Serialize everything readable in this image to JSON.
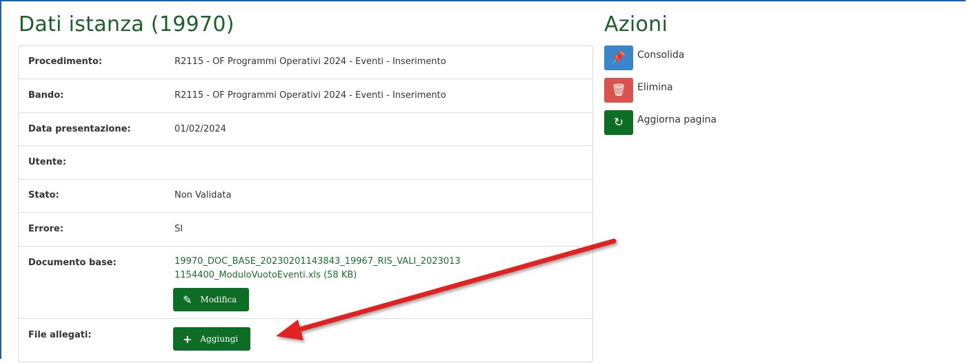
{
  "page": {
    "title": "Dati istanza (19970)",
    "actions_title": "Azioni"
  },
  "details": [
    {
      "label": "Procedimento:",
      "value": "R2115 - OF Programmi Operativi 2024  - Eventi - Inserimento"
    },
    {
      "label": "Bando:",
      "value": "R2115 - OF Programmi Operativi 2024  - Eventi - Inserimento"
    },
    {
      "label": "Data presentazione:",
      "value": "01/02/2024"
    },
    {
      "label": "Utente:",
      "value": ""
    },
    {
      "label": "Stato:",
      "value": "Non Validata"
    },
    {
      "label": "Errore:",
      "value": "SI"
    }
  ],
  "documento_base": {
    "label": "Documento base:",
    "file_link": "19970_DOC_BASE_20230201143843_19967_RIS_VALI_2023013 1154400_ModuloVuotoEventi.xls (58 KB)",
    "button_label": "Modifica",
    "button_icon": "pencil-icon"
  },
  "file_allegati": {
    "label": "File allegati:",
    "button_label": "Aggiungi",
    "button_icon": "plus-icon"
  },
  "actions": [
    {
      "label": "Consolida",
      "icon": "pin-icon",
      "color": "#3a86c8"
    },
    {
      "label": "Elimina",
      "icon": "trash-icon",
      "color": "#d9534f"
    },
    {
      "label": "Aggiorna pagina",
      "icon": "refresh-icon",
      "color": "#0d6d25"
    }
  ],
  "colors": {
    "title_green": "#1e5e2a",
    "button_green": "#0d6d25",
    "frame_blue": "#1f5fa8",
    "annotation_arrow": "#e02020"
  }
}
